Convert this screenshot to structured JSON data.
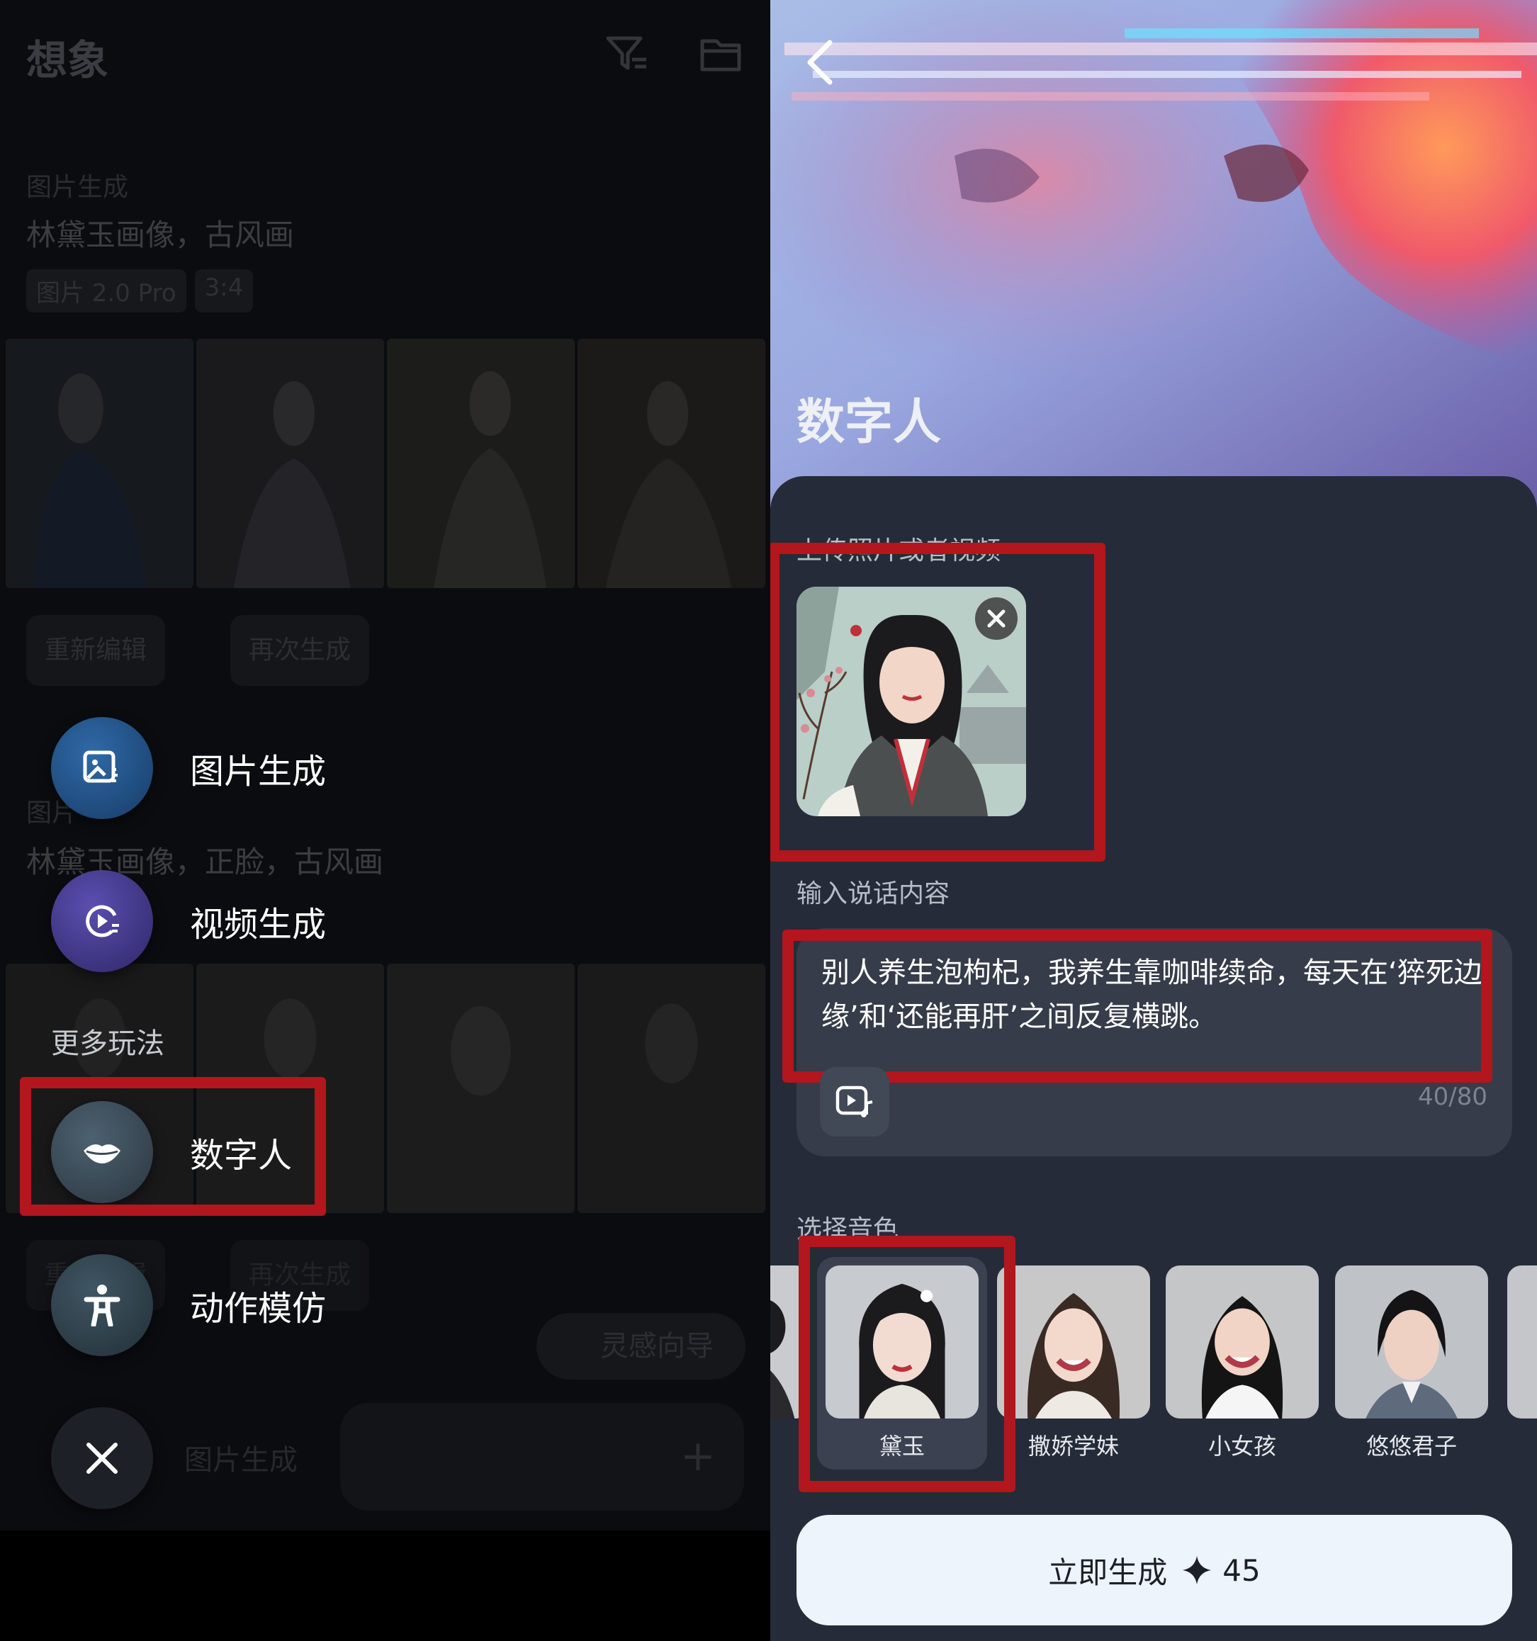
{
  "left": {
    "app_title": "想象",
    "task1": {
      "type_label": "图片生成",
      "prompt": "林黛玉画像，古风画",
      "chips": [
        "图片 2.0 Pro",
        "3:4"
      ]
    },
    "actions": {
      "reedit": "重新编辑",
      "regenerate": "再次生成"
    },
    "task2": {
      "type_label": "图片",
      "prompt": "林黛玉画像，正脸，古风画"
    },
    "inspire": "灵感向导",
    "bottom_input_placeholder": "图片生成",
    "menu": {
      "image_gen": "图片生成",
      "video_gen": "视频生成",
      "more_label": "更多玩法",
      "digital_human": "数字人",
      "motion_mimic": "动作模仿"
    }
  },
  "right": {
    "title": "数字人",
    "upload_label": "上传照片或者视频",
    "speech_label": "输入说话内容",
    "speech_text": "别人养生泡枸杞，我养生靠咖啡续命，每天在‘猝死边缘’和‘还能再肝’之间反复横跳。",
    "char_count": "40/80",
    "voice_label": "选择音色",
    "voices": [
      "黛玉",
      "撒娇学妹",
      "小女孩",
      "悠悠君子"
    ],
    "generate_label": "立即生成",
    "generate_cost": "45"
  },
  "colors": {
    "highlight": "#b3161c",
    "sheet": "#252b38",
    "button": "#eef4fb"
  }
}
